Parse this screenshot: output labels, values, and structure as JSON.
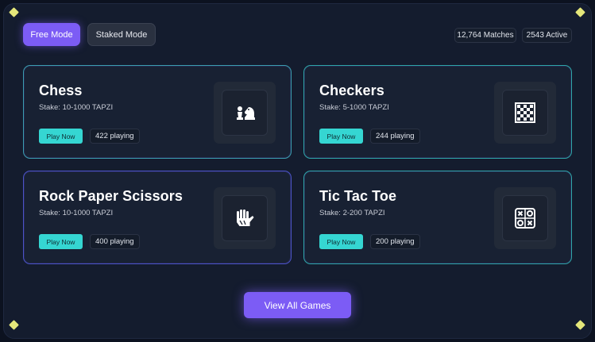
{
  "modes": {
    "free": "Free Mode",
    "staked": "Staked Mode"
  },
  "stats": {
    "matches": "12,764 Matches",
    "active": "2543 Active"
  },
  "games": [
    {
      "title": "Chess",
      "stake": "Stake: 10-1000 TAPZI",
      "play": "Play Now",
      "playing": "422 playing",
      "icon": "chess-icon"
    },
    {
      "title": "Checkers",
      "stake": "Stake: 5-1000 TAPZI",
      "play": "Play Now",
      "playing": "244 playing",
      "icon": "checkers-icon"
    },
    {
      "title": "Rock Paper Scissors",
      "stake": "Stake: 10-1000 TAPZI",
      "play": "Play Now",
      "playing": "400 playing",
      "icon": "hand-icon"
    },
    {
      "title": "Tic Tac Toe",
      "stake": "Stake: 2-200 TAPZI",
      "play": "Play Now",
      "playing": "200 playing",
      "icon": "tic-tac-toe-icon"
    }
  ],
  "view_all": "View All Games",
  "colors": {
    "accent": "#7c5cf5",
    "play": "#35d6d2",
    "background": "#141c2e",
    "spark": "#e5e77a"
  }
}
